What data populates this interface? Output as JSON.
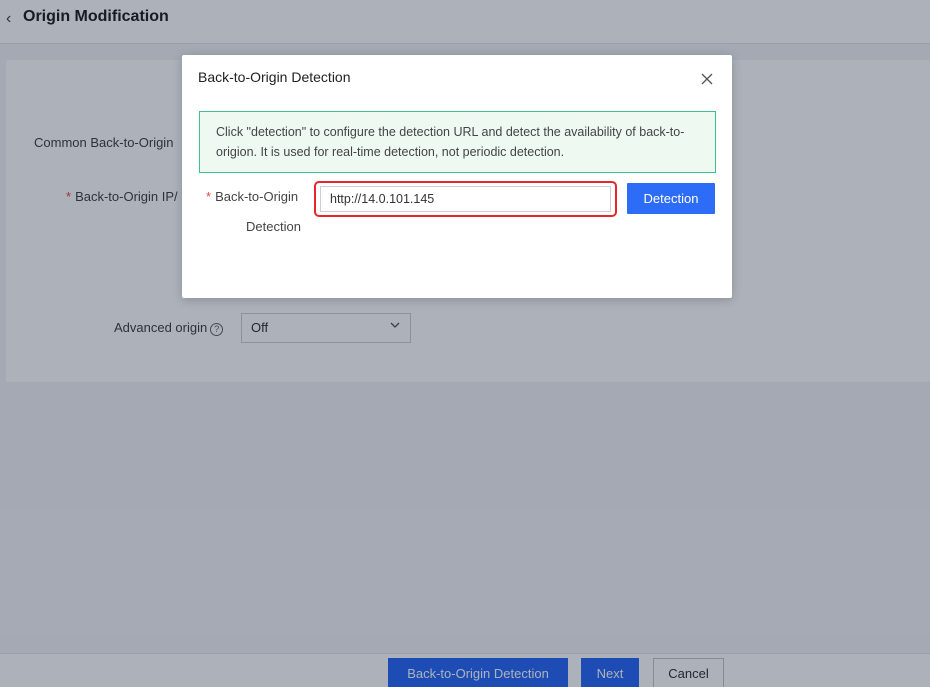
{
  "header": {
    "back_icon": "chevron-left-icon",
    "title": "Origin Modification"
  },
  "form": {
    "label_common": "Common Back-to-Origin",
    "label_ip": "Back-to-Origin IP/",
    "label_advanced": "Advanced origin",
    "advanced_value": "Off",
    "advanced_help_icon": "question-circle-icon",
    "advanced_chevron_icon": "chevron-down-icon"
  },
  "footer": {
    "detection_label": "Back-to-Origin Detection",
    "next_label": "Next",
    "cancel_label": "Cancel"
  },
  "modal": {
    "title": "Back-to-Origin Detection",
    "close_icon": "close-icon",
    "notice": "Click \"detection\" to configure the detection URL and detect the availability of back-to-origion. It is used for real-time detection, not periodic detection.",
    "label_line1": "Back-to-Origin",
    "label_line2": "Detection",
    "url_value": "http://14.0.101.145",
    "detect_label": "Detection"
  },
  "colors": {
    "primary": "#2c6cf6",
    "notice_border": "#3fc28a",
    "notice_bg": "#eefaf1",
    "highlight": "#e8262a",
    "required": "#e54545"
  }
}
